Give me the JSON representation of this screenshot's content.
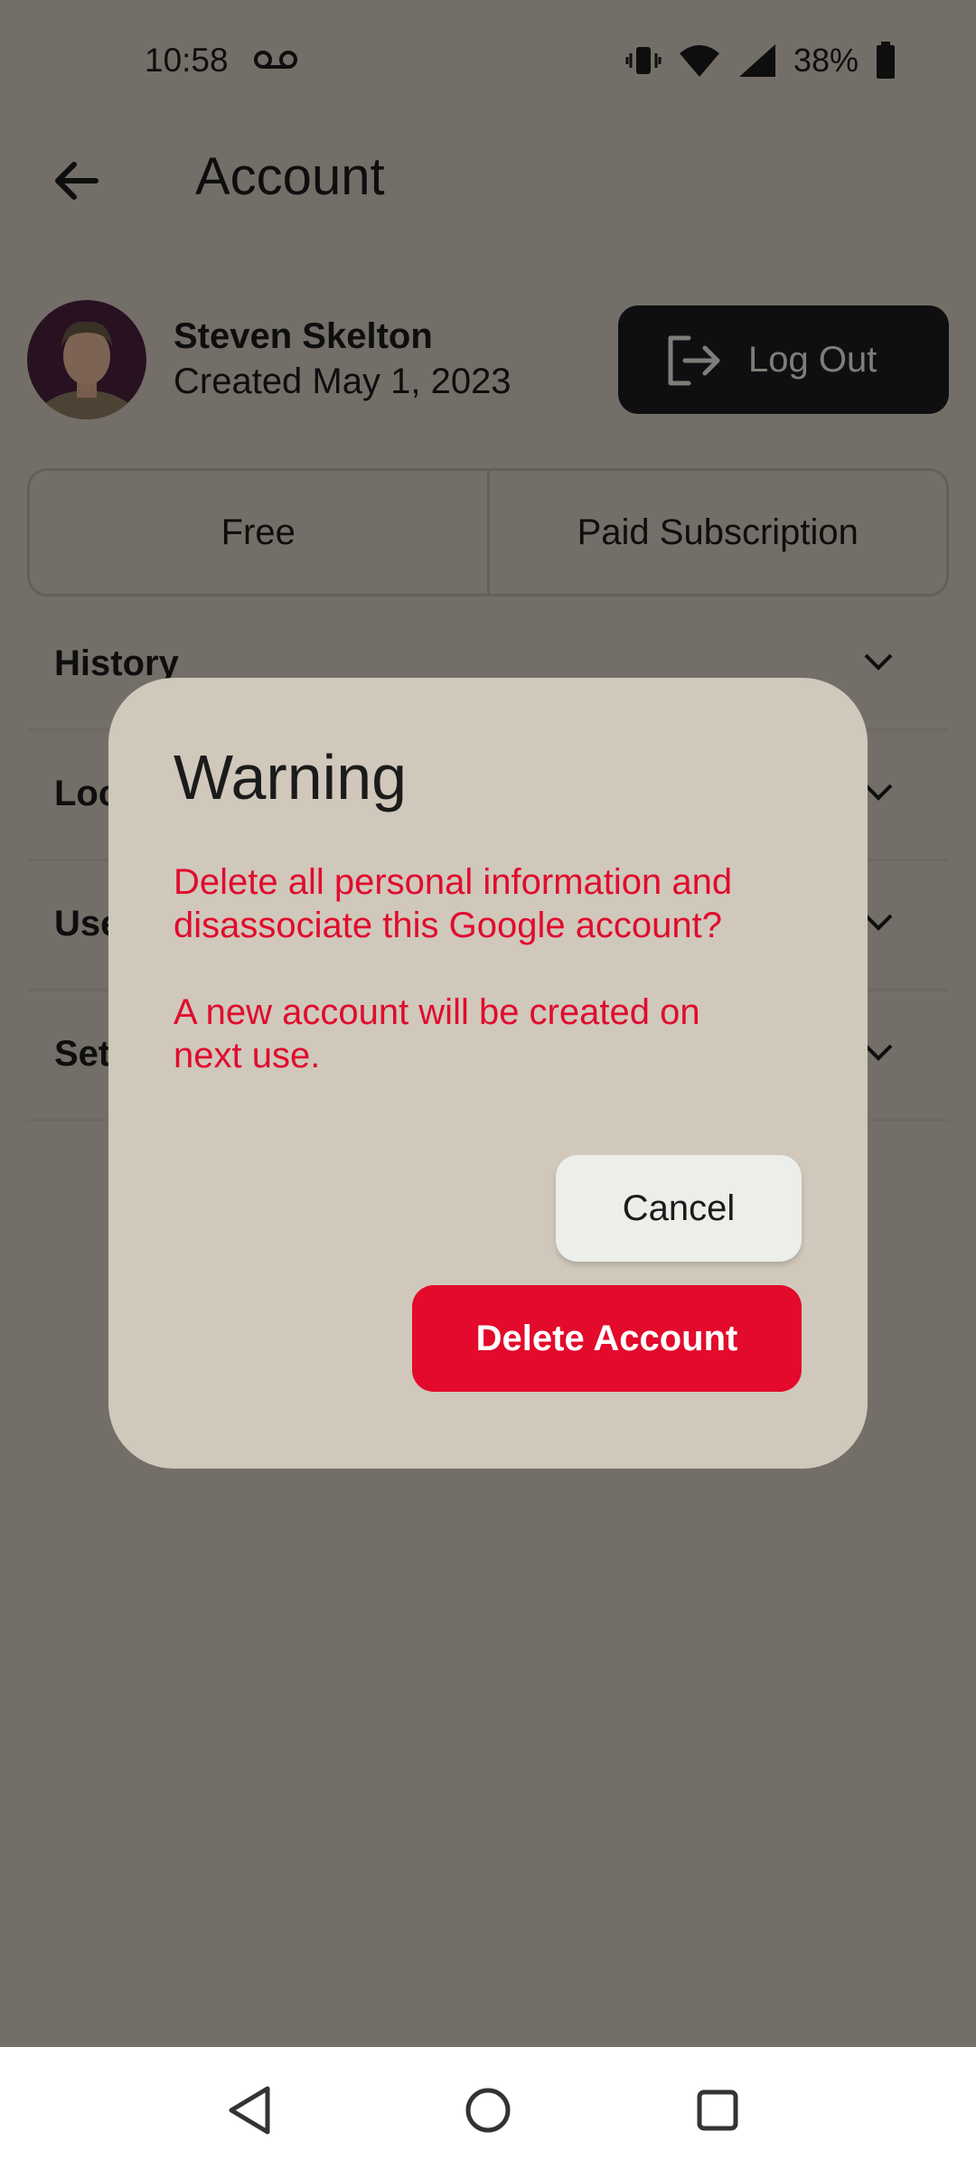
{
  "status_bar": {
    "time": "10:58",
    "battery_percent": "38%",
    "icons": [
      "voicemail-icon",
      "vibrate-icon",
      "wifi-icon",
      "signal-icon",
      "battery-icon"
    ]
  },
  "header": {
    "title": "Account",
    "back_icon": "back-arrow-icon"
  },
  "profile": {
    "name": "Steven Skelton",
    "created": "Created May 1, 2023",
    "logout_label": "Log Out"
  },
  "plans": {
    "options": [
      "Free",
      "Paid Subscription"
    ]
  },
  "sections": [
    {
      "label": "History"
    },
    {
      "label": "Loc"
    },
    {
      "label": "Use"
    },
    {
      "label": "Set"
    }
  ],
  "dialog": {
    "title": "Warning",
    "message_1": "Delete all personal information and disassociate this Google account?",
    "message_2": "A new account will be created on next use.",
    "cancel_label": "Cancel",
    "delete_label": "Delete Account"
  },
  "colors": {
    "background": "#d2cbbe",
    "dialog": "#d0c8bb",
    "danger": "#e30a2c",
    "logout_button": "#1c1c22",
    "cancel_button": "#eceeea"
  }
}
